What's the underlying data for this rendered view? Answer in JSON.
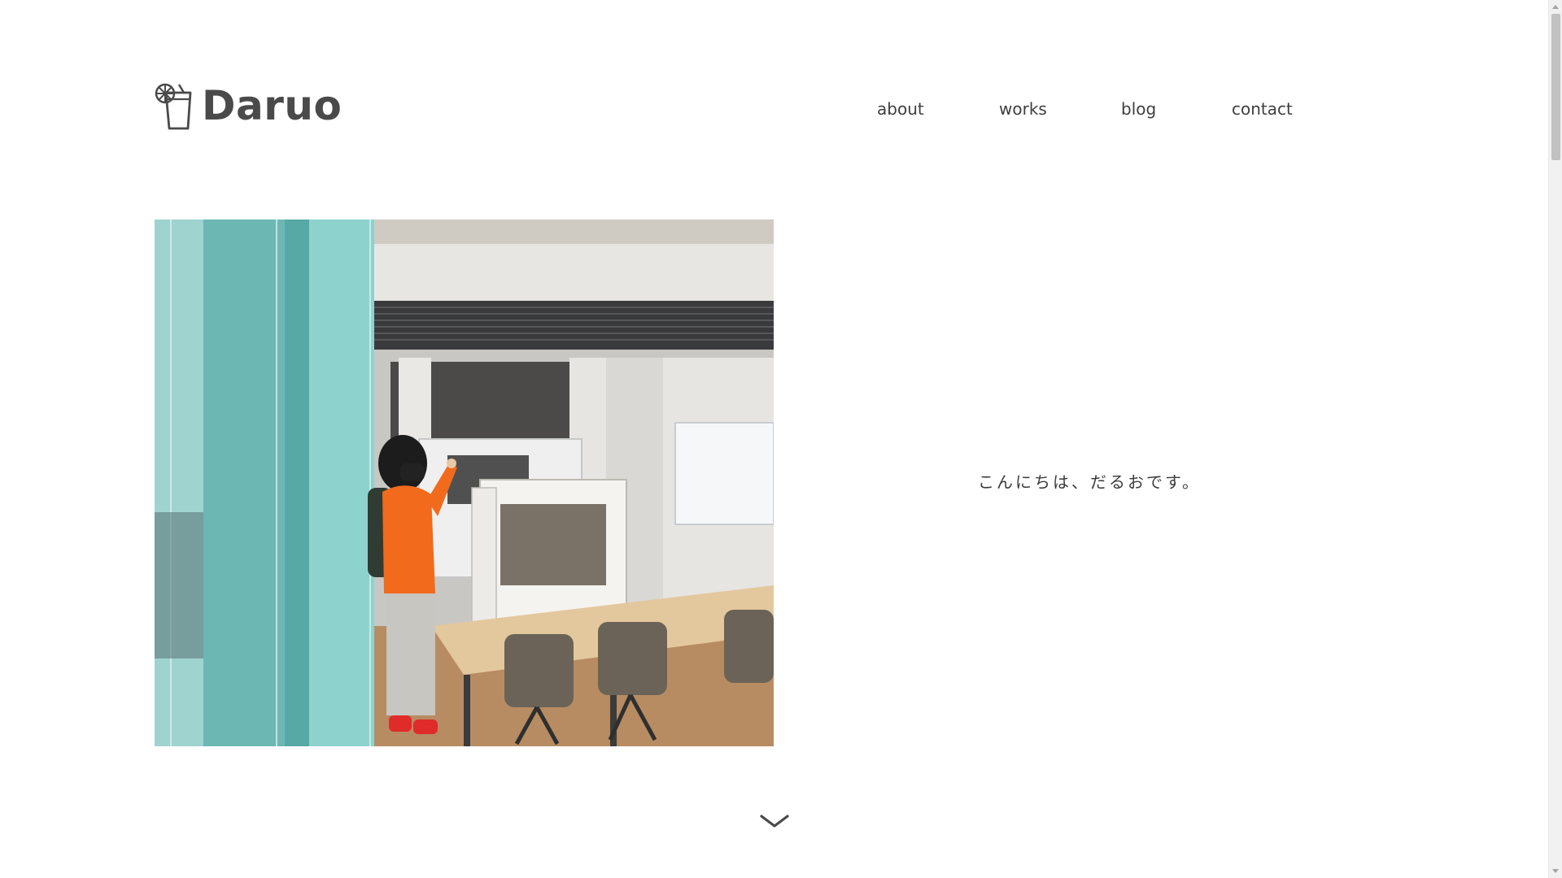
{
  "header": {
    "logo_text": "Daruo",
    "logo_icon": "drink-cup-with-lemon-icon",
    "nav": {
      "about": "about",
      "works": "works",
      "blog": "blog",
      "contact": "contact"
    }
  },
  "hero": {
    "greeting": "こんにちは、だるおです。",
    "photo": "person-in-orange-hoodie-pointing-in-office"
  },
  "scroll": {
    "chevron_icon": "chevron-down-icon"
  },
  "colors": {
    "text": "#444444",
    "background": "#ffffff",
    "hoodie": "#f26a1b"
  }
}
